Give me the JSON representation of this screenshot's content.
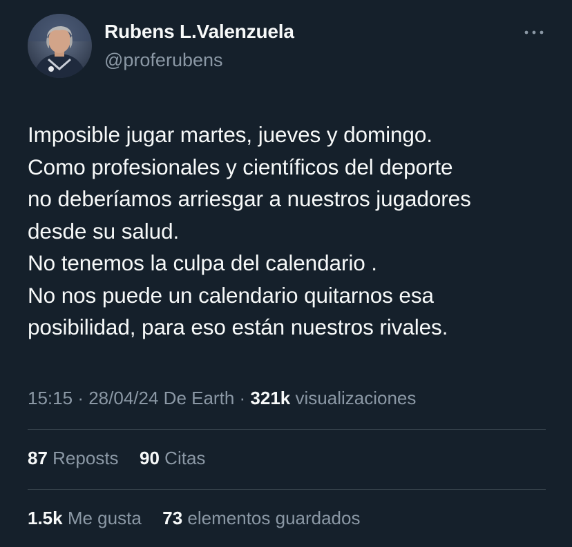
{
  "author": {
    "name": "Rubens L.Valenzuela",
    "handle": "@proferubens"
  },
  "tweet": {
    "lines": [
      "Imposible jugar martes, jueves y domingo.",
      "Como profesionales y científicos del deporte",
      "no deberíamos arriesgar a nuestros jugadores",
      "desde su salud.",
      "No tenemos la culpa del calendario .",
      "No nos puede un calendario quitarnos esa",
      "posibilidad, para eso están nuestros rivales."
    ]
  },
  "meta": {
    "time": "15:15",
    "separator": "·",
    "date": "28/04/24",
    "source": "De Earth",
    "views_count": "321k",
    "views_label": "visualizaciones"
  },
  "stats": {
    "reposts_count": "87",
    "reposts_label": "Reposts",
    "quotes_count": "90",
    "quotes_label": "Citas",
    "likes_count": "1.5k",
    "likes_label": "Me gusta",
    "bookmarks_count": "73",
    "bookmarks_label": "elementos guardados"
  },
  "icons": {
    "more": "more-horizontal-icon"
  },
  "colors": {
    "background": "#15202b",
    "primary_text": "#f7f9f9",
    "secondary_text": "#8b98a5",
    "divider": "#38444d"
  }
}
